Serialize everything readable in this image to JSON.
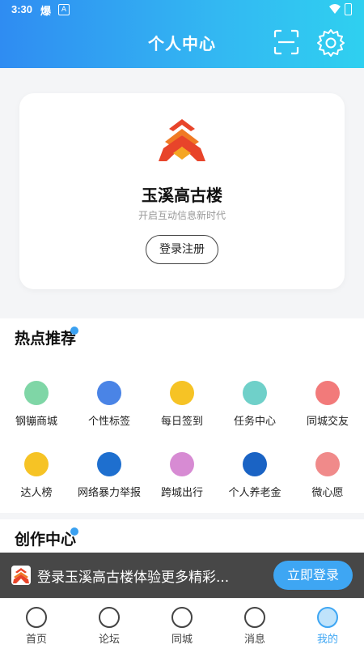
{
  "status": {
    "time": "3:30",
    "bao": "爆",
    "a": "A"
  },
  "header": {
    "title": "个人中心"
  },
  "profile": {
    "app_name": "玉溪高古楼",
    "slogan": "开启互动信息新时代",
    "login_label": "登录注册"
  },
  "hot": {
    "title": "热点推荐",
    "items": [
      {
        "label": "钢镚商城",
        "color": "#7fd6a6"
      },
      {
        "label": "个性标签",
        "color": "#4a84e6"
      },
      {
        "label": "每日签到",
        "color": "#f6c325"
      },
      {
        "label": "任务中心",
        "color": "#6fd0c9"
      },
      {
        "label": "同城交友",
        "color": "#f27a7a"
      },
      {
        "label": "达人榜",
        "color": "#f6c325"
      },
      {
        "label": "网络暴力举报",
        "color": "#1e6fcf"
      },
      {
        "label": "跨城出行",
        "color": "#d78bd3"
      },
      {
        "label": "个人养老金",
        "color": "#1a63c4"
      },
      {
        "label": "微心愿",
        "color": "#f08a8a"
      }
    ]
  },
  "create": {
    "title": "创作中心"
  },
  "login_bar": {
    "text": "登录玉溪高古楼体验更多精彩...",
    "button": "立即登录"
  },
  "tabs": [
    {
      "label": "首页"
    },
    {
      "label": "论坛"
    },
    {
      "label": "同城"
    },
    {
      "label": "消息"
    },
    {
      "label": "我的"
    }
  ]
}
